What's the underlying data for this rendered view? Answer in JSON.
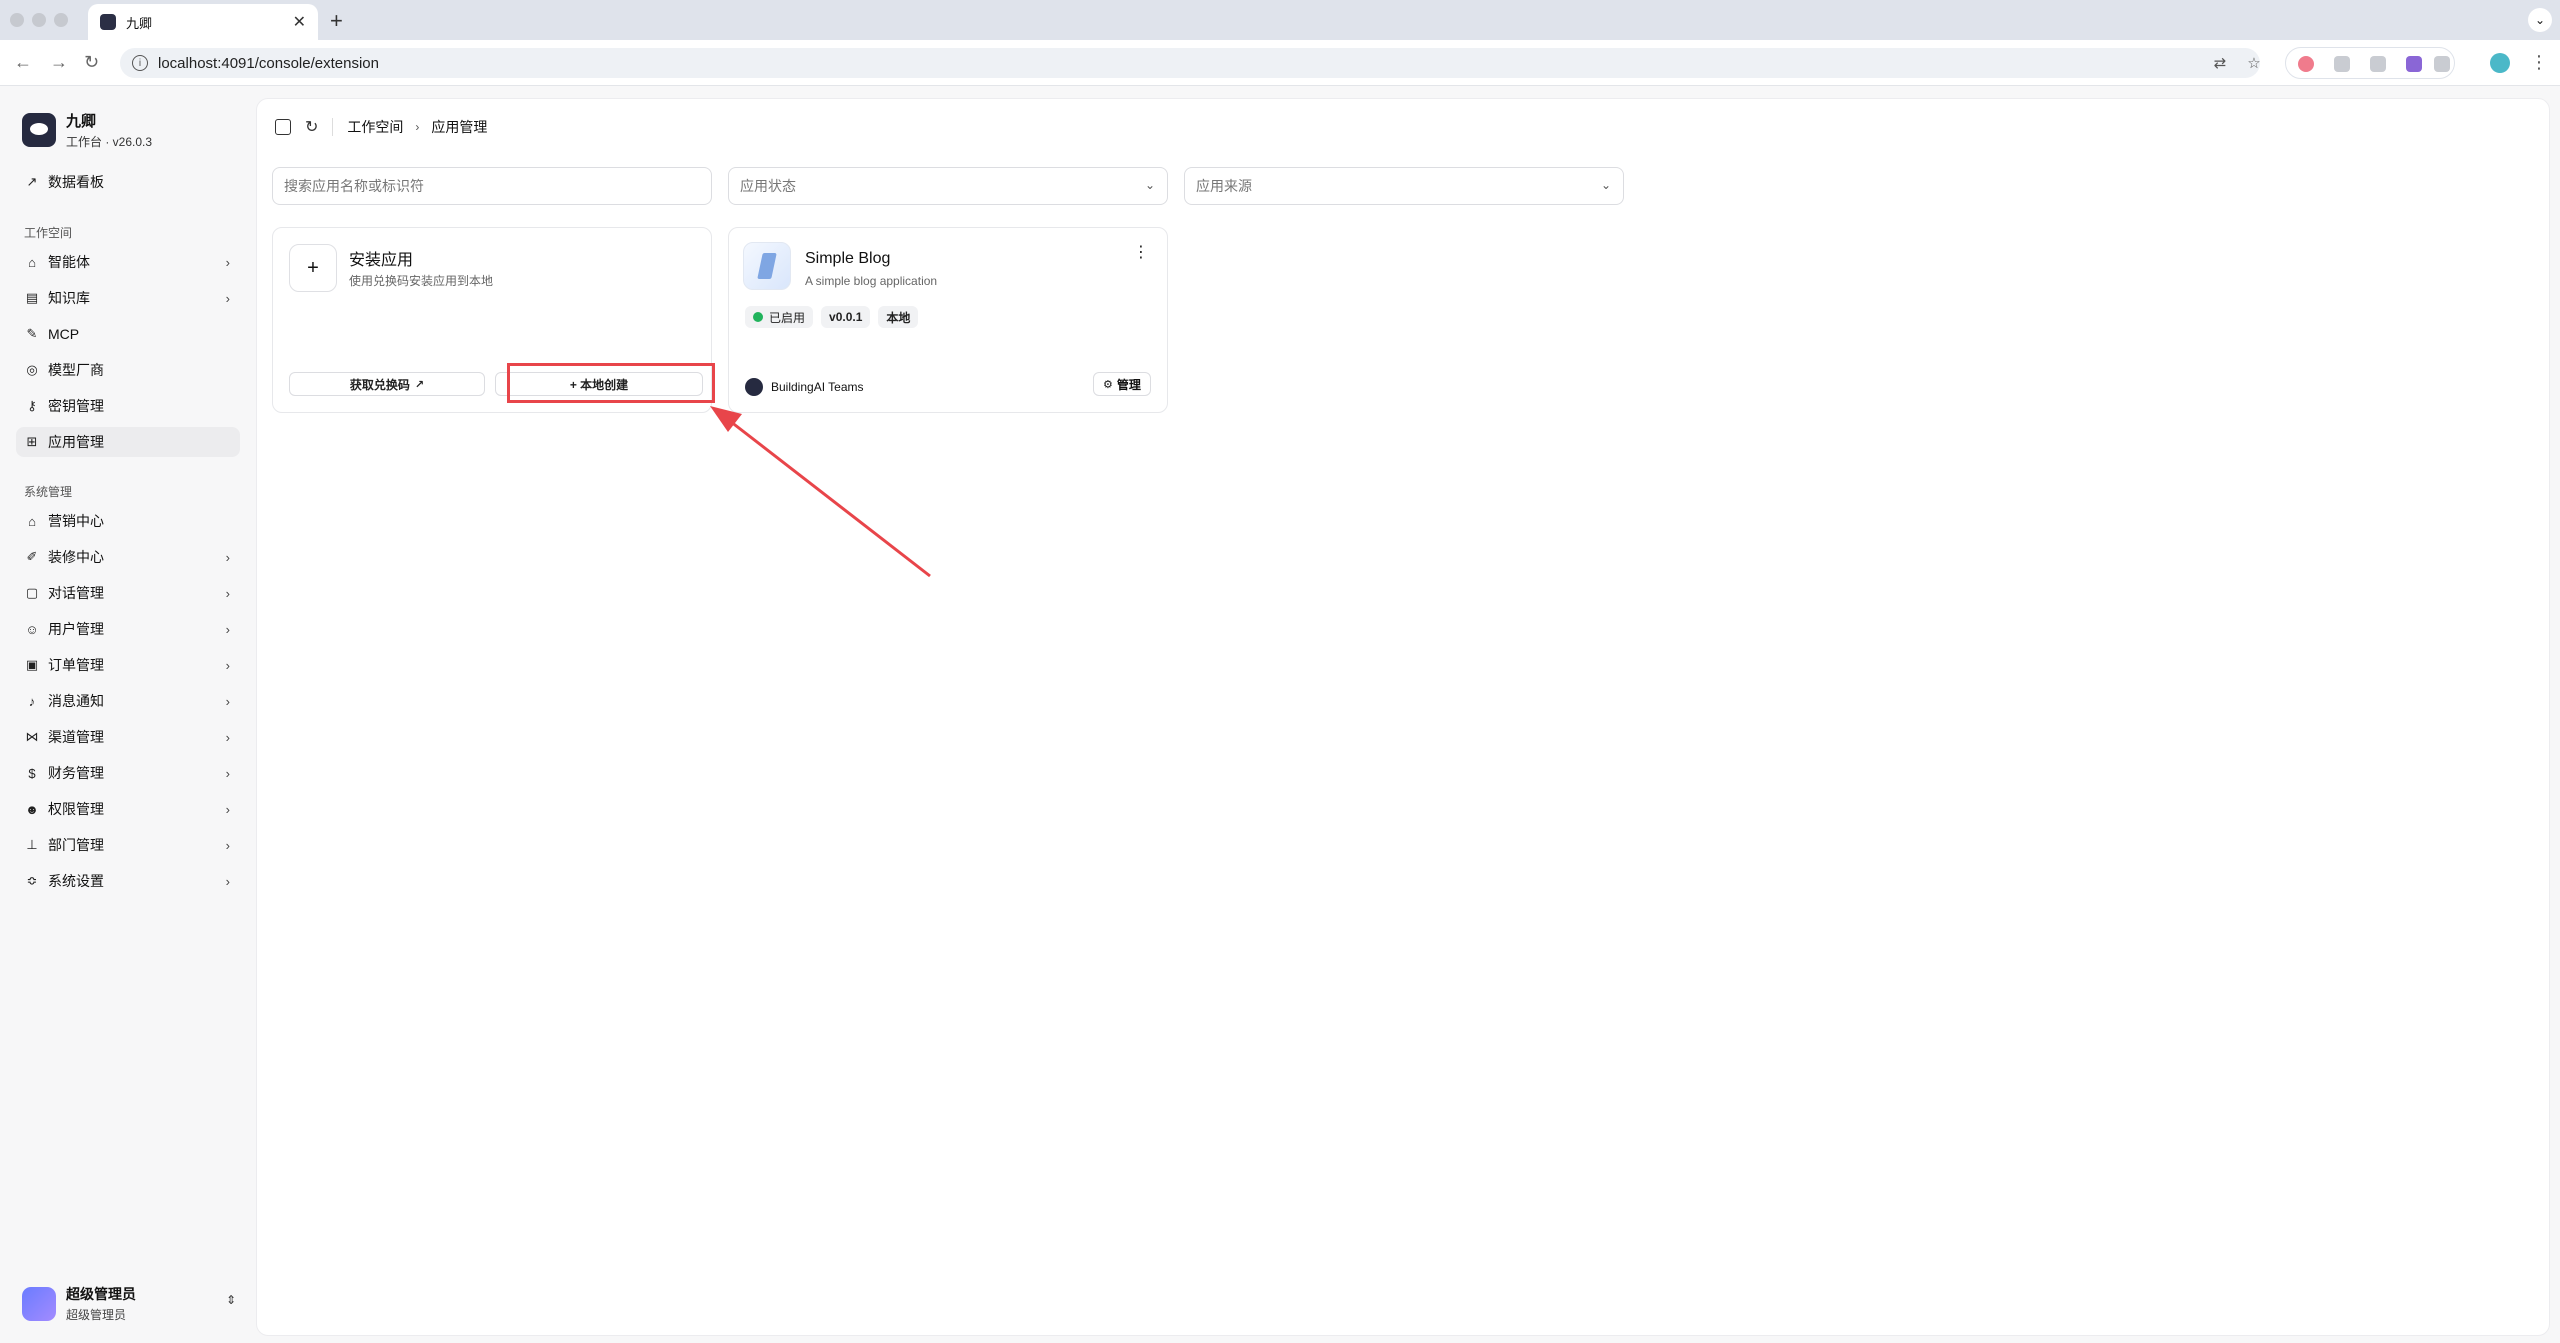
{
  "browser": {
    "tab_title": "九卿",
    "new_tab": "+",
    "close_tab": "✕",
    "url": "localhost:4091/console/extension"
  },
  "sidebar": {
    "brand_name": "九卿",
    "brand_sub": "工作台 · v26.0.3",
    "dashboard": "数据看板",
    "section_workspace": "工作空间",
    "workspace_items": [
      {
        "label": "智能体",
        "icon": "robot-icon"
      },
      {
        "label": "知识库",
        "icon": "book-icon"
      },
      {
        "label": "MCP",
        "icon": "wrench-icon"
      },
      {
        "label": "模型厂商",
        "icon": "model-icon"
      },
      {
        "label": "密钥管理",
        "icon": "key-icon"
      },
      {
        "label": "应用管理",
        "icon": "grid-icon"
      }
    ],
    "section_system": "系统管理",
    "system_items": [
      {
        "label": "营销中心",
        "icon": "store-icon"
      },
      {
        "label": "装修中心",
        "icon": "brush-icon"
      },
      {
        "label": "对话管理",
        "icon": "chat-icon"
      },
      {
        "label": "用户管理",
        "icon": "users-icon"
      },
      {
        "label": "订单管理",
        "icon": "clipboard-icon"
      },
      {
        "label": "消息通知",
        "icon": "bell-icon"
      },
      {
        "label": "渠道管理",
        "icon": "share-icon"
      },
      {
        "label": "财务管理",
        "icon": "dollar-icon"
      },
      {
        "label": "权限管理",
        "icon": "user-lock-icon"
      },
      {
        "label": "部门管理",
        "icon": "org-icon"
      },
      {
        "label": "系统设置",
        "icon": "settings-icon"
      }
    ],
    "user_name": "超级管理员",
    "user_role": "超级管理员"
  },
  "main": {
    "breadcrumb": [
      "工作空间",
      "应用管理"
    ],
    "search_placeholder": "搜索应用名称或标识符",
    "status_placeholder": "应用状态",
    "source_placeholder": "应用来源",
    "install_card": {
      "title": "安装应用",
      "desc": "使用兑换码安装应用到本地",
      "get_code": "获取兑换码",
      "local_create": "+ 本地创建"
    },
    "app_card": {
      "name": "Simple Blog",
      "desc": "A simple blog application",
      "status": "已启用",
      "version": "v0.0.1",
      "source": "本地",
      "author": "BuildingAI Teams",
      "manage": "管理"
    }
  },
  "colors": {
    "highlight": "#e8454a",
    "status_green": "#21b35c"
  }
}
